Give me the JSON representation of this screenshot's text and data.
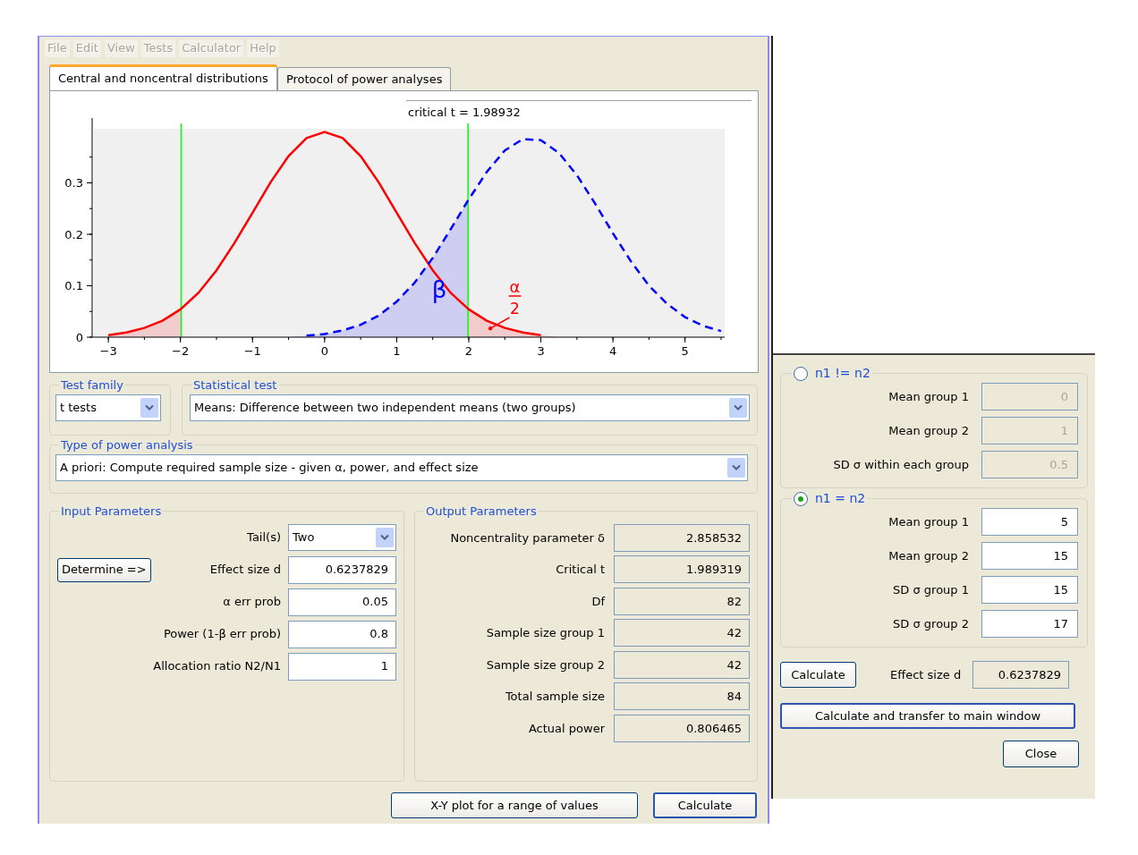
{
  "menu": [
    {
      "label": "File",
      "disabled": true
    },
    {
      "label": "Edit",
      "disabled": true
    },
    {
      "label": "View",
      "disabled": true
    },
    {
      "label": "Tests",
      "disabled": true
    },
    {
      "label": "Calculator",
      "disabled": true
    },
    {
      "label": "Help",
      "disabled": true
    }
  ],
  "tabs": [
    {
      "label": "Central and noncentral distributions",
      "selected": true
    },
    {
      "label": "Protocol of power analyses",
      "selected": false
    }
  ],
  "plot": {
    "caption": "critical t = 1.98932",
    "chart_data": {
      "type": "line",
      "x": [
        -3,
        -2.75,
        -2.5,
        -2.25,
        -2,
        -1.75,
        -1.5,
        -1.25,
        -1,
        -0.75,
        -0.5,
        -0.25,
        0,
        0.25,
        0.5,
        0.75,
        1,
        1.25,
        1.5,
        1.75,
        2,
        2.25,
        2.5,
        2.75,
        3,
        3.25,
        3.5,
        3.75,
        4,
        4.25,
        4.5,
        4.75,
        5,
        5.25,
        5.5
      ],
      "series": [
        {
          "color": "#ff0000",
          "line_style": "solid",
          "values": [
            0.004,
            0.009,
            0.018,
            0.032,
            0.054,
            0.086,
            0.13,
            0.183,
            0.242,
            0.301,
            0.352,
            0.387,
            0.399,
            0.387,
            0.352,
            0.301,
            0.242,
            0.183,
            0.13,
            0.086,
            0.054,
            0.032,
            0.018,
            0.009,
            0.004,
            null,
            null,
            null,
            null,
            null,
            null,
            null,
            null,
            null,
            null
          ]
        },
        {
          "color": "#0000ff",
          "line_style": "dashed",
          "values": [
            null,
            null,
            null,
            null,
            null,
            null,
            null,
            null,
            null,
            null,
            null,
            0.003,
            0.006,
            0.013,
            0.024,
            0.042,
            0.069,
            0.106,
            0.154,
            0.21,
            0.268,
            0.321,
            0.363,
            0.385,
            0.383,
            0.358,
            0.315,
            0.26,
            0.202,
            0.147,
            0.1,
            0.065,
            0.039,
            0.022,
            0.012
          ]
        }
      ],
      "xlim": [
        -3.2,
        5.55
      ],
      "ylim": [
        0,
        0.405
      ],
      "xticks": [
        -3,
        -2,
        -1,
        0,
        1,
        2,
        3,
        4,
        5
      ],
      "yticks": [
        0,
        0.1,
        0.2,
        0.3
      ],
      "ref_lines": [
        {
          "axis": "x",
          "value": -1.99
        },
        {
          "axis": "x",
          "value": 1.99
        }
      ],
      "annotations": [
        "β",
        "α",
        "2"
      ]
    }
  },
  "test_family": {
    "title": "Test family",
    "value": "t tests"
  },
  "statistical_test": {
    "title": "Statistical test",
    "value": "Means: Difference between two independent means (two groups)"
  },
  "power_analysis_type": {
    "title": "Type of power analysis",
    "value": "A priori: Compute required sample size - given α, power, and effect size"
  },
  "input_parameters": {
    "title": "Input Parameters",
    "rows": [
      {
        "kind": "dropdown",
        "label": "Tail(s)",
        "value": "Two"
      },
      {
        "kind": "field",
        "label": "Effect size d",
        "value": "0.6237829",
        "button": "Determine =>"
      },
      {
        "kind": "field",
        "label": "α err prob",
        "value": "0.05"
      },
      {
        "kind": "field",
        "label": "Power (1-β err prob)",
        "value": "0.8"
      },
      {
        "kind": "field",
        "label": "Allocation ratio N2/N1",
        "value": "1"
      }
    ]
  },
  "output_parameters": {
    "title": "Output Parameters",
    "rows": [
      {
        "label": "Noncentrality parameter δ",
        "value": "2.858532"
      },
      {
        "label": "Critical t",
        "value": "1.989319"
      },
      {
        "label": "Df",
        "value": "82"
      },
      {
        "label": "Sample size group 1",
        "value": "42"
      },
      {
        "label": "Sample size group 2",
        "value": "42"
      },
      {
        "label": "Total sample size",
        "value": "84"
      },
      {
        "label": "Actual power",
        "value": "0.806465"
      }
    ]
  },
  "buttons": [
    {
      "label": "X-Y plot for a range of values",
      "default": false
    },
    {
      "label": "Calculate",
      "default": true
    }
  ],
  "effect_size_dialog": {
    "groups": [
      {
        "label": "n1 != n2",
        "selected": false,
        "fields": [
          {
            "label": "Mean group 1",
            "value": "0"
          },
          {
            "label": "Mean group 2",
            "value": "1"
          },
          {
            "label": "SD σ within each group",
            "value": "0.5"
          }
        ]
      },
      {
        "label": "n1 = n2",
        "selected": true,
        "fields": [
          {
            "label": "Mean group 1",
            "value": "5"
          },
          {
            "label": "Mean group 2",
            "value": "15"
          },
          {
            "label": "SD σ group 1",
            "value": "15"
          },
          {
            "label": "SD σ group 2",
            "value": "17"
          }
        ]
      }
    ],
    "calculate_button": "Calculate",
    "result_label": "Effect size d",
    "result_value": "0.6237829",
    "transfer_button": {
      "label": "Calculate and transfer to main window",
      "default": true
    },
    "close_button": "Close"
  }
}
